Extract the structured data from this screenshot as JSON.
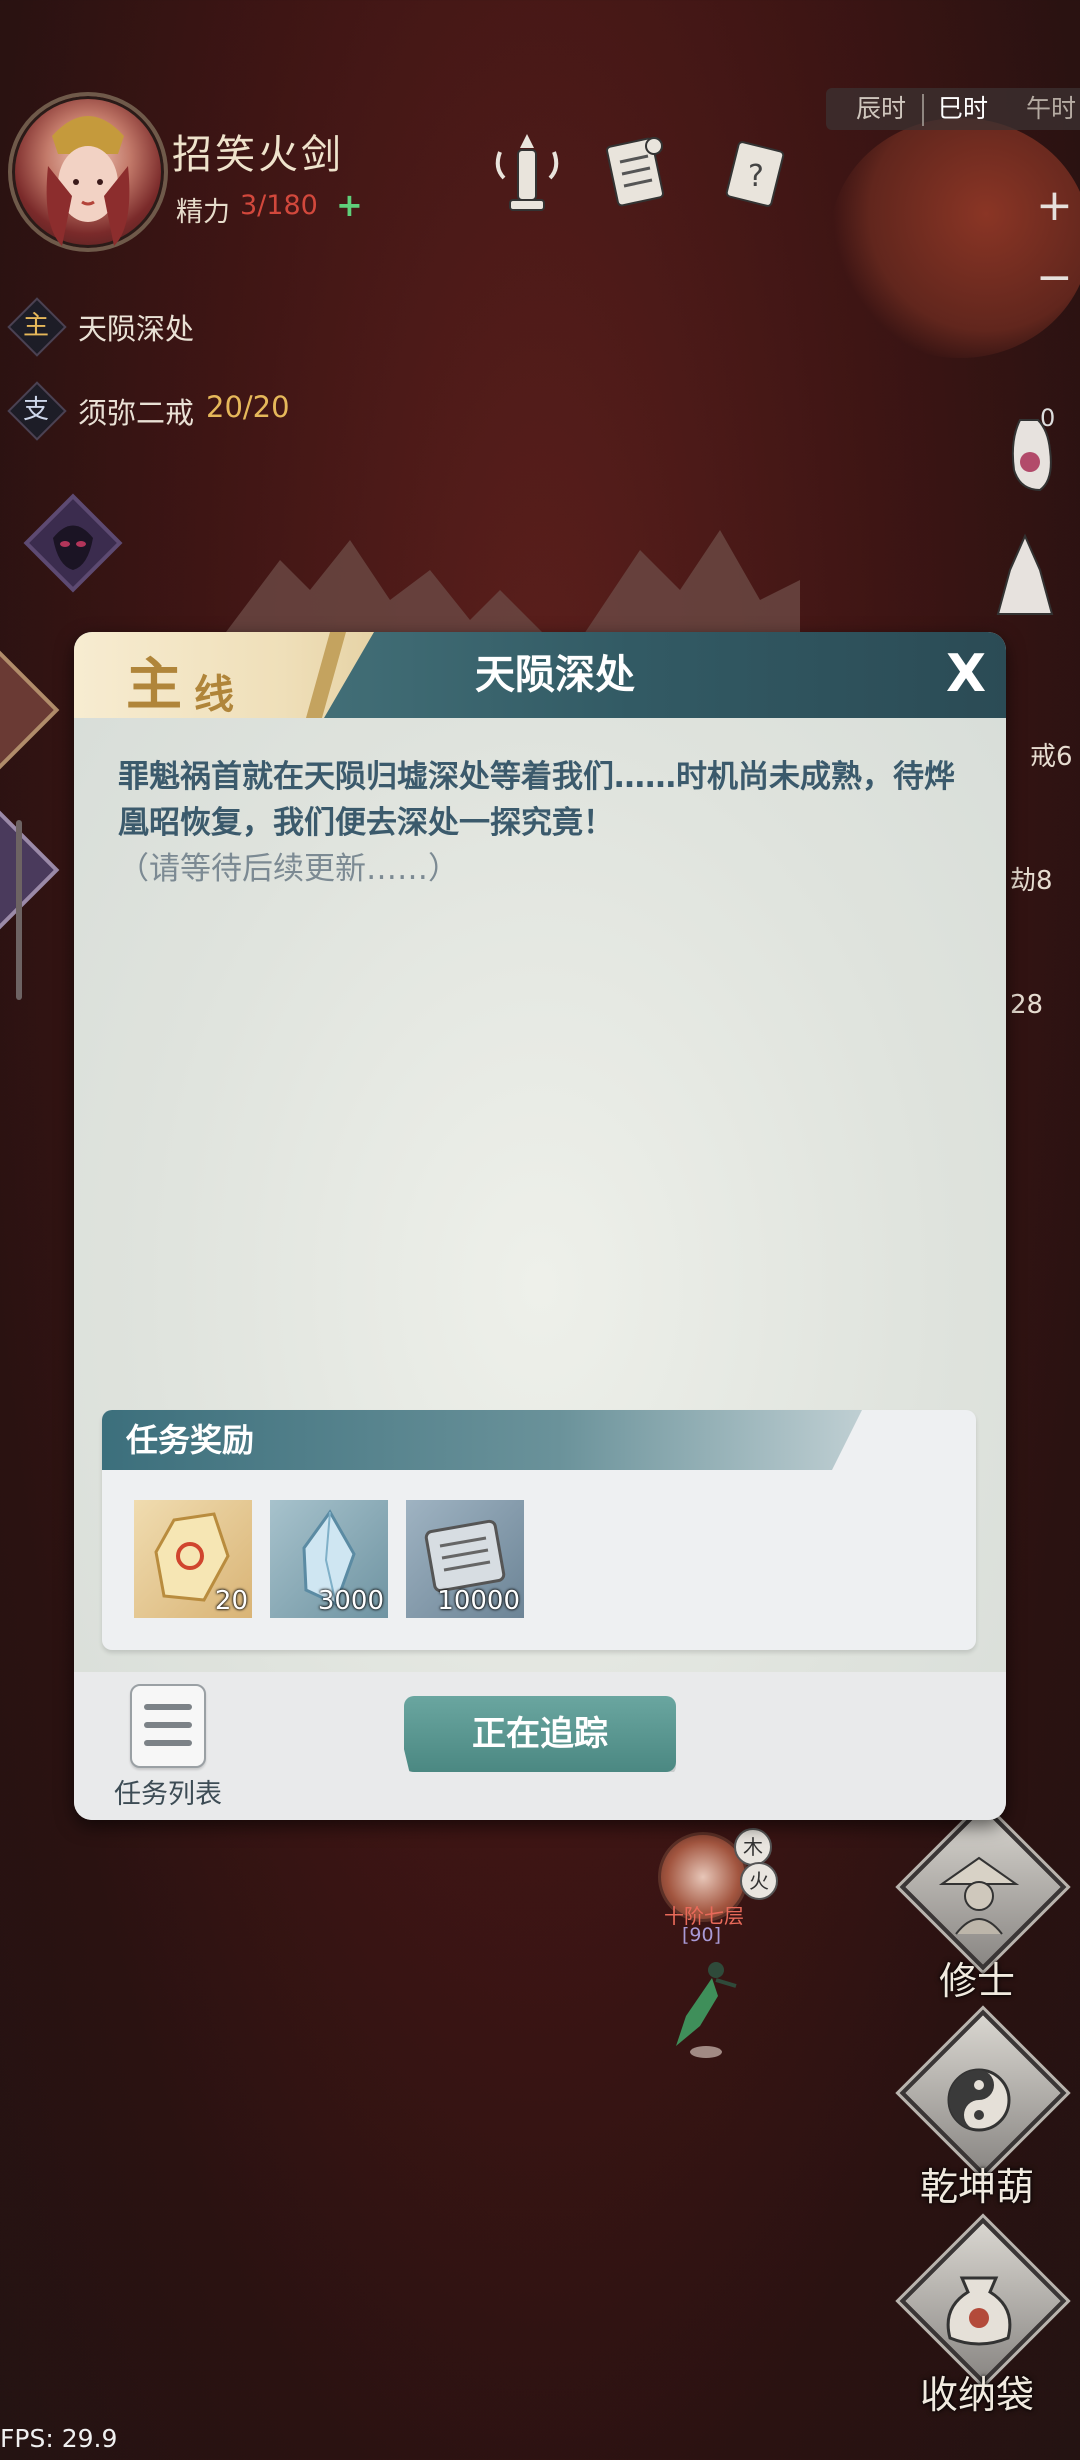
{
  "player": {
    "name": "招笑火剑",
    "stamina_label": "精力",
    "stamina_value": "3/180",
    "stamina_plus": "+"
  },
  "time_bar": [
    "辰时",
    "巳时",
    "午时"
  ],
  "zoom": {
    "in": "+",
    "out": "−"
  },
  "quests": {
    "main_tag": "主",
    "main_name": "天陨深处",
    "side_tag": "支",
    "side_name": "须弥二戒",
    "side_progress": "20/20"
  },
  "right_partials": [
    "戒6",
    "劫8",
    "28"
  ],
  "right_icon_count": "0",
  "dialog": {
    "tab_big": "主",
    "tab_small": "线",
    "title": "天陨深处",
    "close": "X",
    "description": "罪魁祸首就在天陨归墟深处等着我们……时机尚未成熟，待烨凰昭恢复，我们便去深处一探究竟！",
    "note": "（请等待后续更新……）",
    "reward_title": "任务奖励",
    "rewards": [
      {
        "icon": "gold-crystal-icon",
        "amount": "20"
      },
      {
        "icon": "blue-crystal-icon",
        "amount": "3000"
      },
      {
        "icon": "scroll-icon",
        "amount": "10000"
      }
    ],
    "list_label": "任务列表",
    "track_button": "正在追踪"
  },
  "marker": {
    "elem_wood": "木",
    "elem_fire": "火",
    "rank": "十阶七层",
    "level": "[90]"
  },
  "side_buttons": {
    "cultivator": "修士",
    "gourd": "乾坤葫",
    "bag": "收纳袋"
  },
  "fps": "FPS: 29.9",
  "colors": {
    "accent_teal": "#4b8882",
    "stamina_red": "#d2483c",
    "quest_gold": "#e6b85a",
    "description_blue": "#3b5a6c"
  }
}
